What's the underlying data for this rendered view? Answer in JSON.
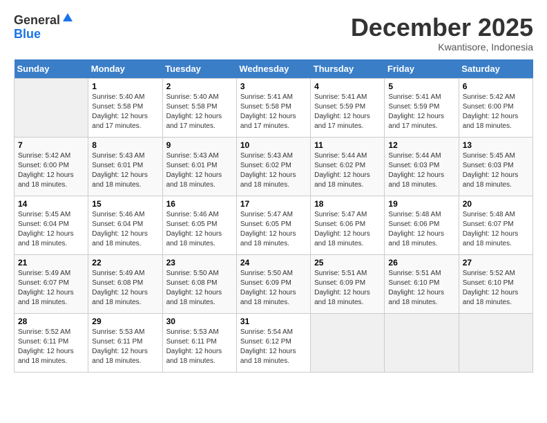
{
  "header": {
    "logo_general": "General",
    "logo_blue": "Blue",
    "month_title": "December 2025",
    "subtitle": "Kwantisore, Indonesia"
  },
  "days_of_week": [
    "Sunday",
    "Monday",
    "Tuesday",
    "Wednesday",
    "Thursday",
    "Friday",
    "Saturday"
  ],
  "weeks": [
    [
      {
        "day": "",
        "info": ""
      },
      {
        "day": "1",
        "info": "Sunrise: 5:40 AM\nSunset: 5:58 PM\nDaylight: 12 hours and 17 minutes."
      },
      {
        "day": "2",
        "info": "Sunrise: 5:40 AM\nSunset: 5:58 PM\nDaylight: 12 hours and 17 minutes."
      },
      {
        "day": "3",
        "info": "Sunrise: 5:41 AM\nSunset: 5:58 PM\nDaylight: 12 hours and 17 minutes."
      },
      {
        "day": "4",
        "info": "Sunrise: 5:41 AM\nSunset: 5:59 PM\nDaylight: 12 hours and 17 minutes."
      },
      {
        "day": "5",
        "info": "Sunrise: 5:41 AM\nSunset: 5:59 PM\nDaylight: 12 hours and 17 minutes."
      },
      {
        "day": "6",
        "info": "Sunrise: 5:42 AM\nSunset: 6:00 PM\nDaylight: 12 hours and 18 minutes."
      }
    ],
    [
      {
        "day": "7",
        "info": "Sunrise: 5:42 AM\nSunset: 6:00 PM\nDaylight: 12 hours and 18 minutes."
      },
      {
        "day": "8",
        "info": "Sunrise: 5:43 AM\nSunset: 6:01 PM\nDaylight: 12 hours and 18 minutes."
      },
      {
        "day": "9",
        "info": "Sunrise: 5:43 AM\nSunset: 6:01 PM\nDaylight: 12 hours and 18 minutes."
      },
      {
        "day": "10",
        "info": "Sunrise: 5:43 AM\nSunset: 6:02 PM\nDaylight: 12 hours and 18 minutes."
      },
      {
        "day": "11",
        "info": "Sunrise: 5:44 AM\nSunset: 6:02 PM\nDaylight: 12 hours and 18 minutes."
      },
      {
        "day": "12",
        "info": "Sunrise: 5:44 AM\nSunset: 6:03 PM\nDaylight: 12 hours and 18 minutes."
      },
      {
        "day": "13",
        "info": "Sunrise: 5:45 AM\nSunset: 6:03 PM\nDaylight: 12 hours and 18 minutes."
      }
    ],
    [
      {
        "day": "14",
        "info": "Sunrise: 5:45 AM\nSunset: 6:04 PM\nDaylight: 12 hours and 18 minutes."
      },
      {
        "day": "15",
        "info": "Sunrise: 5:46 AM\nSunset: 6:04 PM\nDaylight: 12 hours and 18 minutes."
      },
      {
        "day": "16",
        "info": "Sunrise: 5:46 AM\nSunset: 6:05 PM\nDaylight: 12 hours and 18 minutes."
      },
      {
        "day": "17",
        "info": "Sunrise: 5:47 AM\nSunset: 6:05 PM\nDaylight: 12 hours and 18 minutes."
      },
      {
        "day": "18",
        "info": "Sunrise: 5:47 AM\nSunset: 6:06 PM\nDaylight: 12 hours and 18 minutes."
      },
      {
        "day": "19",
        "info": "Sunrise: 5:48 AM\nSunset: 6:06 PM\nDaylight: 12 hours and 18 minutes."
      },
      {
        "day": "20",
        "info": "Sunrise: 5:48 AM\nSunset: 6:07 PM\nDaylight: 12 hours and 18 minutes."
      }
    ],
    [
      {
        "day": "21",
        "info": "Sunrise: 5:49 AM\nSunset: 6:07 PM\nDaylight: 12 hours and 18 minutes."
      },
      {
        "day": "22",
        "info": "Sunrise: 5:49 AM\nSunset: 6:08 PM\nDaylight: 12 hours and 18 minutes."
      },
      {
        "day": "23",
        "info": "Sunrise: 5:50 AM\nSunset: 6:08 PM\nDaylight: 12 hours and 18 minutes."
      },
      {
        "day": "24",
        "info": "Sunrise: 5:50 AM\nSunset: 6:09 PM\nDaylight: 12 hours and 18 minutes."
      },
      {
        "day": "25",
        "info": "Sunrise: 5:51 AM\nSunset: 6:09 PM\nDaylight: 12 hours and 18 minutes."
      },
      {
        "day": "26",
        "info": "Sunrise: 5:51 AM\nSunset: 6:10 PM\nDaylight: 12 hours and 18 minutes."
      },
      {
        "day": "27",
        "info": "Sunrise: 5:52 AM\nSunset: 6:10 PM\nDaylight: 12 hours and 18 minutes."
      }
    ],
    [
      {
        "day": "28",
        "info": "Sunrise: 5:52 AM\nSunset: 6:11 PM\nDaylight: 12 hours and 18 minutes."
      },
      {
        "day": "29",
        "info": "Sunrise: 5:53 AM\nSunset: 6:11 PM\nDaylight: 12 hours and 18 minutes."
      },
      {
        "day": "30",
        "info": "Sunrise: 5:53 AM\nSunset: 6:11 PM\nDaylight: 12 hours and 18 minutes."
      },
      {
        "day": "31",
        "info": "Sunrise: 5:54 AM\nSunset: 6:12 PM\nDaylight: 12 hours and 18 minutes."
      },
      {
        "day": "",
        "info": ""
      },
      {
        "day": "",
        "info": ""
      },
      {
        "day": "",
        "info": ""
      }
    ]
  ]
}
